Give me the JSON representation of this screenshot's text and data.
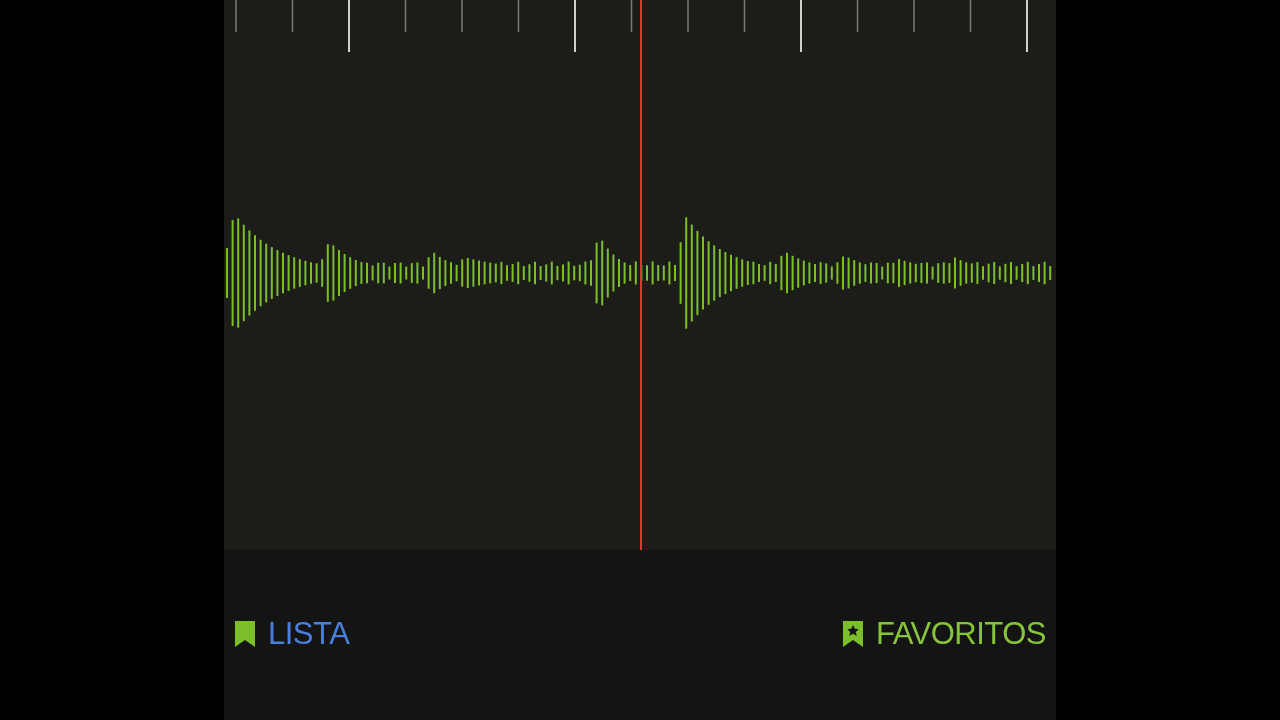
{
  "buttons": [
    {
      "label": "LISTA",
      "kind": "list",
      "color": "#4a7fdc"
    },
    {
      "label": "FAVORITOS",
      "kind": "favorites",
      "color": "#86c43a"
    }
  ]
}
